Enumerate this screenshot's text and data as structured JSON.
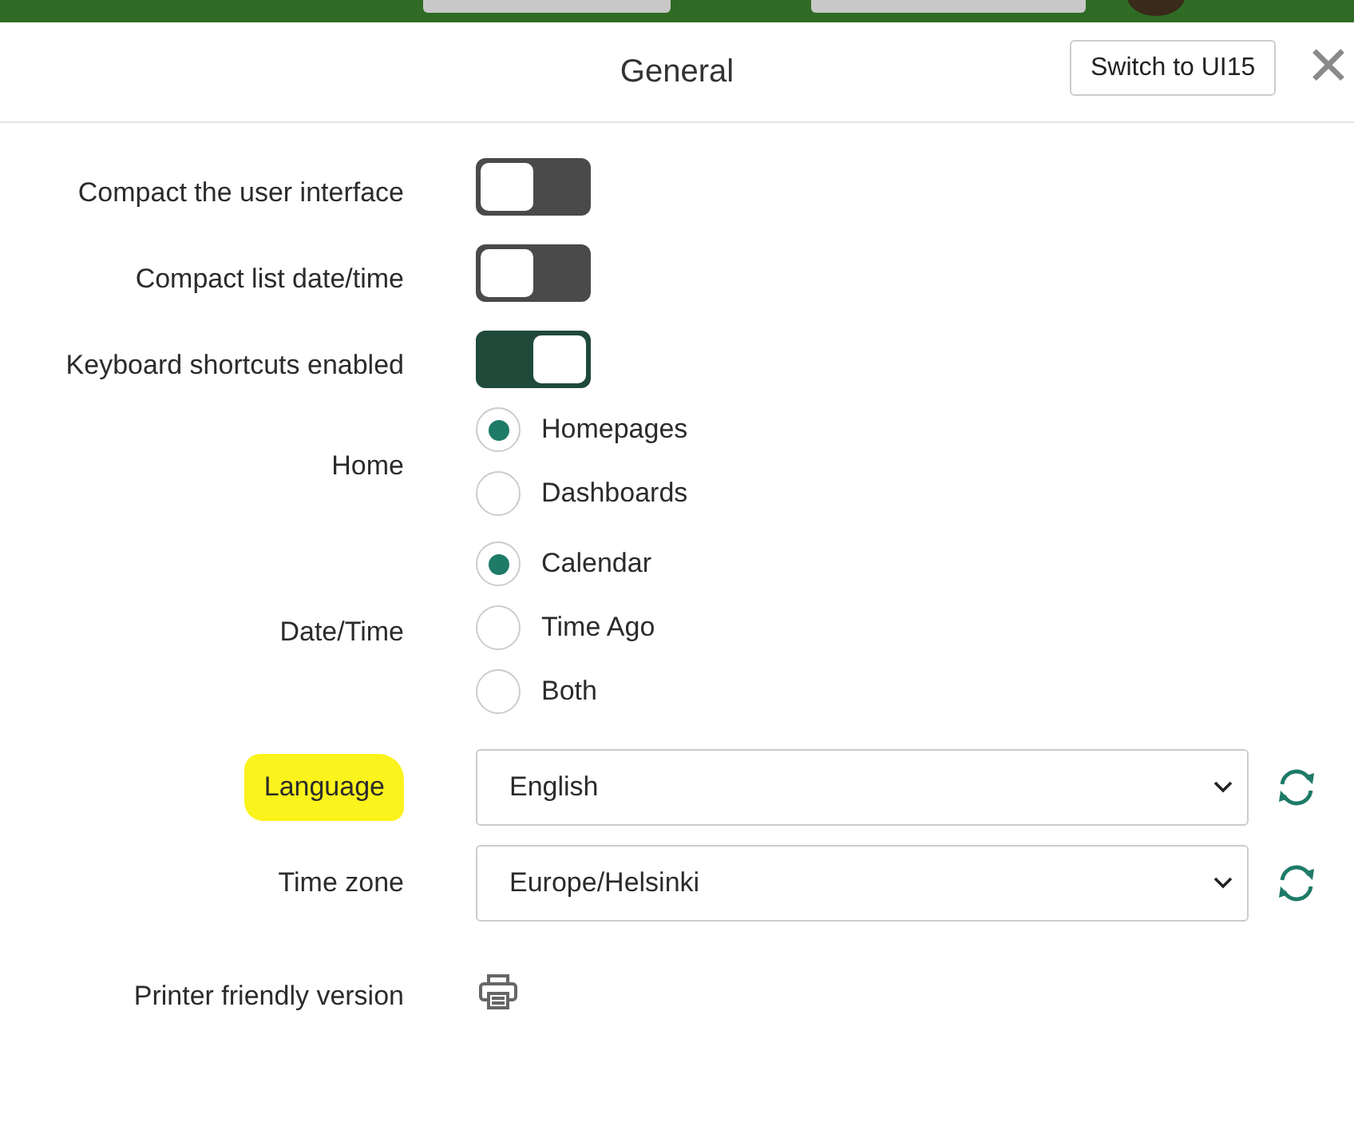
{
  "header": {
    "title": "General",
    "switch_button": "Switch to UI15",
    "close_label": "✕"
  },
  "settings": [
    {
      "kind": "toggle",
      "label": "Compact the user interface",
      "on": false
    },
    {
      "kind": "toggle",
      "label": "Compact list date/time",
      "on": false
    },
    {
      "kind": "toggle",
      "label": "Keyboard shortcuts enabled",
      "on": true
    },
    {
      "kind": "radio",
      "label": "Home",
      "options": [
        {
          "label": "Homepages",
          "selected": true
        },
        {
          "label": "Dashboards",
          "selected": false
        }
      ]
    },
    {
      "kind": "radio",
      "label": "Date/Time",
      "options": [
        {
          "label": "Calendar",
          "selected": true
        },
        {
          "label": "Time Ago",
          "selected": false
        },
        {
          "label": "Both",
          "selected": false
        }
      ]
    },
    {
      "kind": "select",
      "label": "Language",
      "value": "English",
      "highlighted": true
    },
    {
      "kind": "select",
      "label": "Time zone",
      "value": "Europe/Helsinki",
      "highlighted": false
    },
    {
      "kind": "print",
      "label": "Printer friendly version"
    }
  ]
}
